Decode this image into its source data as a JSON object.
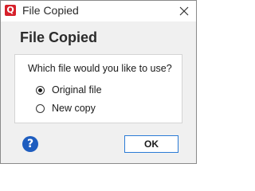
{
  "window": {
    "title": "File Copied",
    "app_icon_letter": "Q",
    "app_icon_color": "#d6202a",
    "close_icon": "close-icon"
  },
  "dialog": {
    "heading": "File Copied",
    "question": "Which file would you like to use?",
    "options": [
      {
        "label": "Original file",
        "selected": true
      },
      {
        "label": "New copy",
        "selected": false
      }
    ]
  },
  "footer": {
    "help_icon": "help-icon",
    "help_glyph": "?",
    "help_color": "#1e5dbf",
    "ok_label": "OK",
    "ok_border_color": "#2b7bd6"
  }
}
